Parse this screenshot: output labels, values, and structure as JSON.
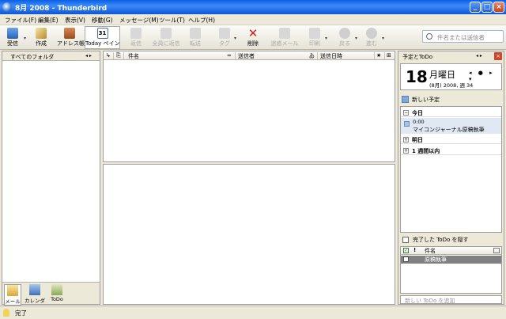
{
  "window": {
    "title": "8月 2008 - Thunderbird",
    "min": "_",
    "max": "□",
    "close": "×"
  },
  "menu": [
    "ファイル(F)",
    "編集(E)",
    "表示(V)",
    "移動(G)",
    "メッセージ(M)",
    "ツール(T)",
    "ヘルプ(H)"
  ],
  "toolbar": {
    "get": "受信",
    "write": "作成",
    "address": "アドレス帳",
    "today": "Today ペイン",
    "reply": "返信",
    "reply_all": "全員に返信",
    "forward": "転送",
    "tag": "タグ",
    "delete": "削除",
    "junk": "迷惑メール",
    "print": "印刷",
    "back": "戻る",
    "next": "進む",
    "cal_day": "31"
  },
  "search": {
    "placeholder": "件名または送信者"
  },
  "folder_pane": {
    "header": "すべてのフォルダ",
    "arrows": "◂ ▸"
  },
  "modes": {
    "mail": "メール",
    "calendar": "カレンダー",
    "todo": "ToDo"
  },
  "thread_columns": {
    "subject": "件名",
    "sender": "送信者",
    "date": "送信日時"
  },
  "today_pane": {
    "header": "予定とToDo",
    "arrows": "◂ ▸",
    "close": "×",
    "day": "18",
    "weekday": "月曜日",
    "nav": "◂ ● ▸ ▾",
    "week_info": "(8月) 2008, 週 34",
    "new_event": "新しい予定",
    "groups": {
      "today": "今日",
      "tomorrow": "明日",
      "week": "1 週間以内"
    },
    "event": {
      "time": "0:00",
      "title": "マイコンジャーナル原稿執筆"
    },
    "hide_done": "完了した ToDo を隠す",
    "todo_columns": {
      "done": "✓",
      "priority": "!",
      "title": "件名"
    },
    "todo_items": [
      {
        "title": "原稿執筆"
      }
    ],
    "add_todo_placeholder": "新しい ToDo を追加"
  },
  "status": {
    "text": "完了"
  },
  "colors": {
    "titlebar": "#0a5fe8",
    "close": "#d0442a",
    "background": "#ece9d8",
    "selected_todo": "#808080"
  }
}
